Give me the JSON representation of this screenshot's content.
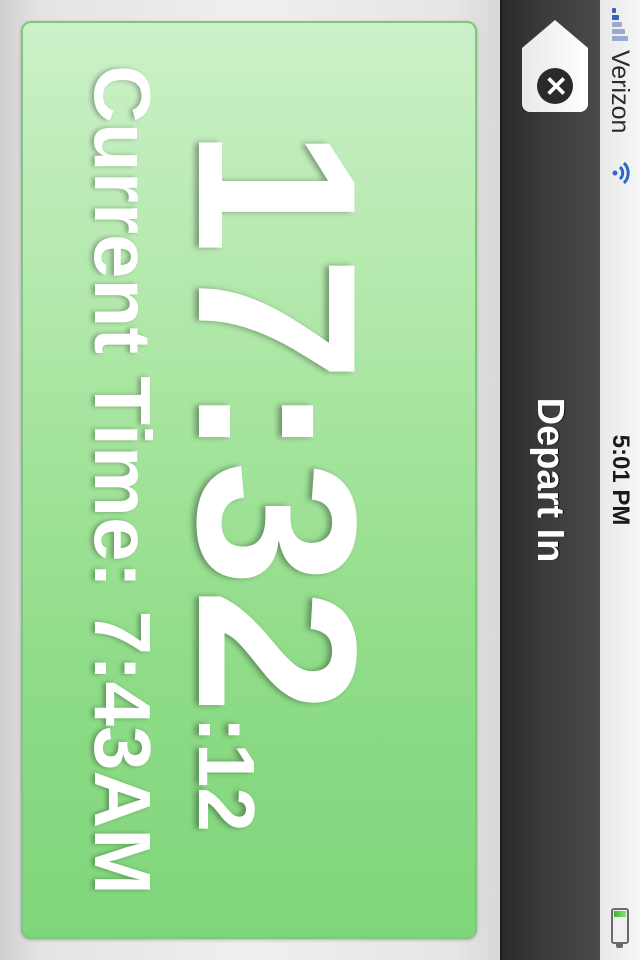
{
  "status_bar": {
    "carrier": "Verizon",
    "time": "5:01 PM",
    "signal_icon": "signal-bars-icon",
    "wifi_icon": "wifi-icon",
    "battery_icon": "battery-icon",
    "battery_level": 0.2
  },
  "nav": {
    "title": "Depart In",
    "close_icon": "close-icon"
  },
  "countdown": {
    "hours_minutes": "17:32",
    "seconds": ":12"
  },
  "current_time": {
    "label": "Current Time:",
    "value": "7:43AM"
  },
  "colors": {
    "card_green": "#8fdc88",
    "navbar": "#3b3b3b",
    "text": "#ffffff"
  }
}
